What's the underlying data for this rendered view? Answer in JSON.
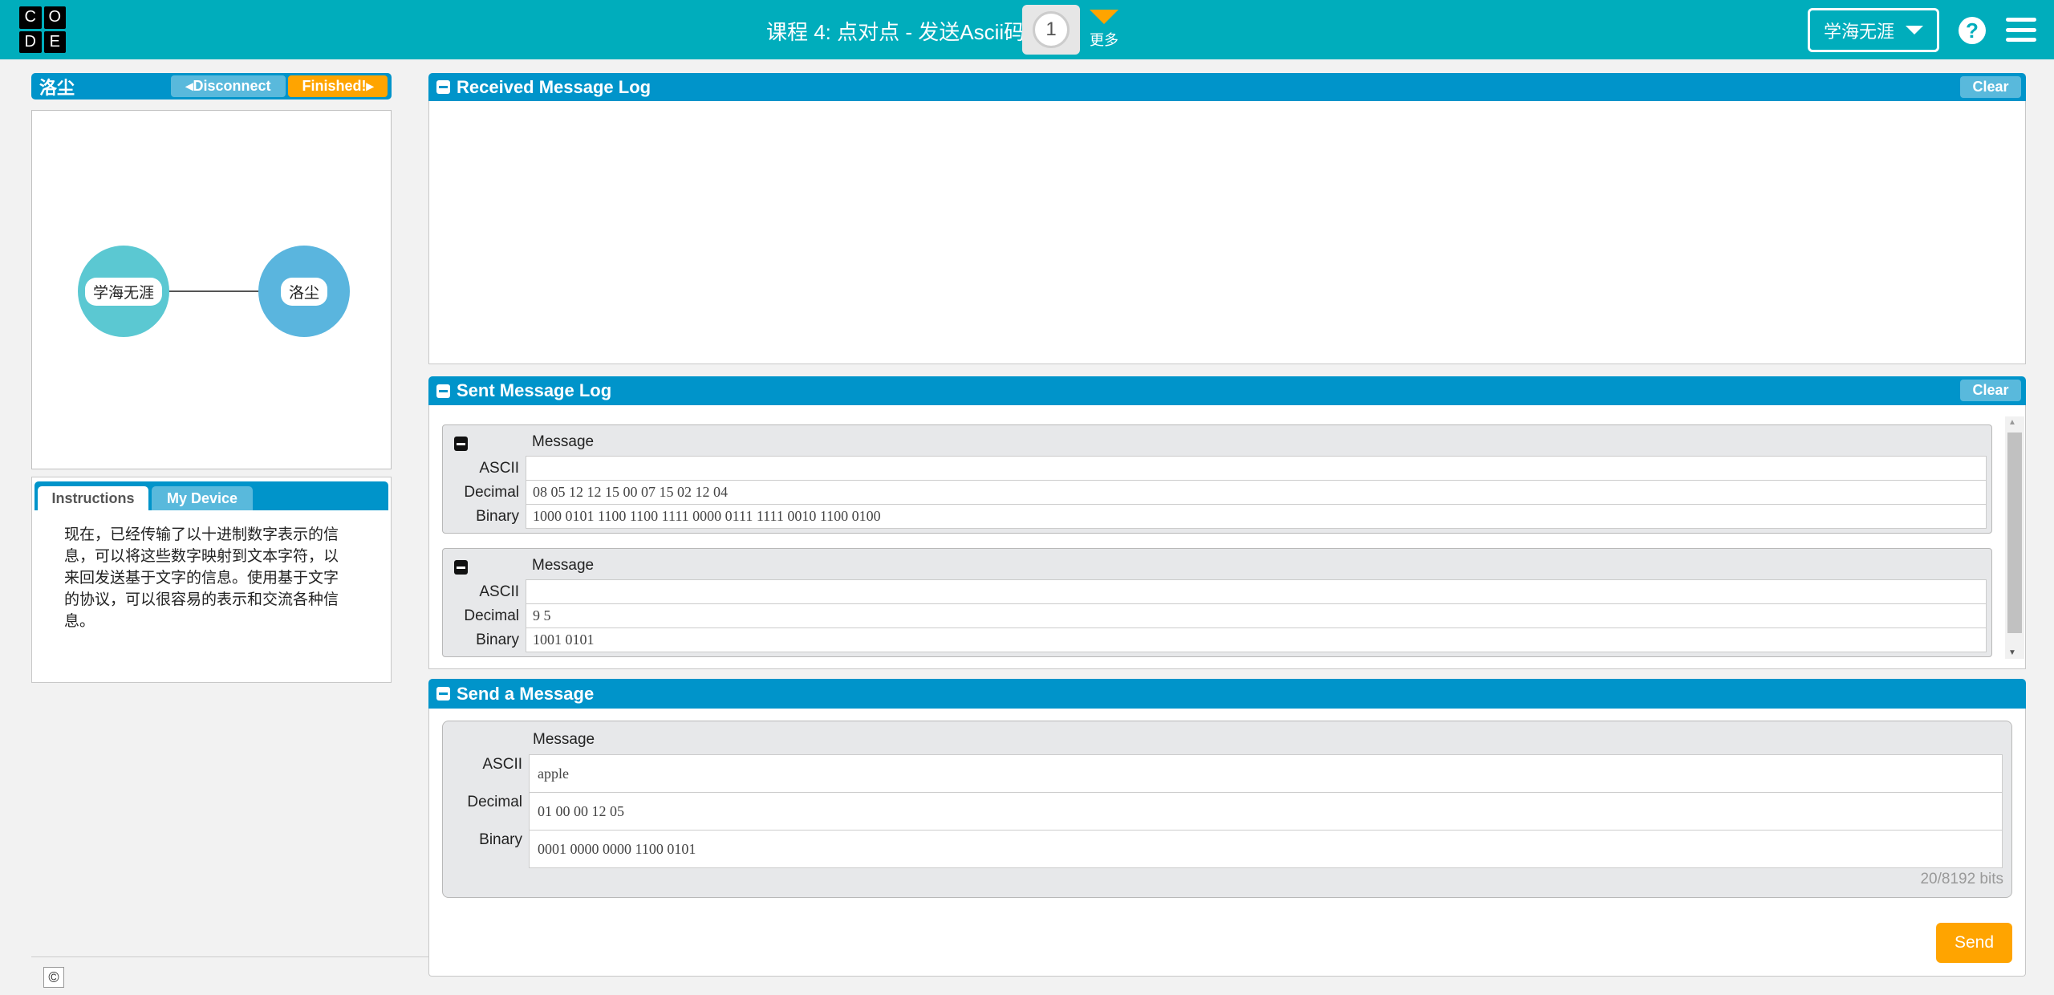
{
  "header": {
    "logo_letters": [
      "C",
      "O",
      "D",
      "E"
    ],
    "title": "课程 4: 点对点 - 发送Ascii码",
    "level": "1",
    "more_label": "更多",
    "user": "学海无涯",
    "help": "?",
    "bg_color": "#00adbc"
  },
  "left": {
    "name": "洛尘",
    "disconnect": "Disconnect",
    "finished": "Finished!",
    "nodes": [
      {
        "label": "学海无涯",
        "color": "#5bc8d2"
      },
      {
        "label": "洛尘",
        "color": "#5ab5de"
      }
    ],
    "tabs": [
      {
        "label": "Instructions",
        "active": true
      },
      {
        "label": "My Device",
        "active": false
      }
    ],
    "instructions": "现在，已经传输了以十进制数字表示的信息，可以将这些数字映射到文本字符，以来回发送基于文字的信息。使用基于文字的协议，可以很容易的表示和交流各种信息。"
  },
  "received": {
    "title": "Received Message Log",
    "clear": "Clear"
  },
  "sent": {
    "title": "Sent Message Log",
    "clear": "Clear",
    "message_label": "Message",
    "row_labels": [
      "ASCII",
      "Decimal",
      "Binary"
    ],
    "messages": [
      {
        "ascii": "",
        "decimal": "08 05 12 12 15 00 07 15 02 12 04",
        "binary": "1000 0101 1100 1100 1111 0000 0111 1111 0010 1100 0100"
      },
      {
        "ascii": "",
        "decimal": "9 5",
        "binary": "1001 0101"
      }
    ]
  },
  "send": {
    "title": "Send a Message",
    "message_label": "Message",
    "row_labels": [
      "ASCII",
      "Decimal",
      "Binary"
    ],
    "ascii": "apple",
    "decimal": "01 00 00 12 05",
    "binary": "0001 0000 0000 1100 0101",
    "bits": "20/8192 bits",
    "send": "Send"
  },
  "footer": {
    "copyright": "©"
  },
  "colors": {
    "panel_header": "#0094ca",
    "accent": "#ffa400"
  }
}
